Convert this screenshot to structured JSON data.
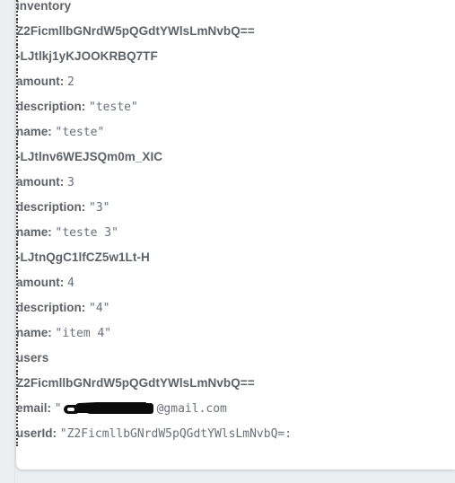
{
  "panel": {
    "name": "firebase-realtime-database-tree"
  },
  "tree": {
    "toggle_icon": "collapse-minus-icon",
    "roots": [
      {
        "label": "inventory",
        "children": [
          {
            "label": "Z2FicmllbGNrdW5pQGdtYWlsLmNvbQ==",
            "children": [
              {
                "label": "-LJtlkj1yKJOOKRBQ7TF",
                "leaves": [
                  {
                    "key": "amount:",
                    "value": "2"
                  },
                  {
                    "key": "description:",
                    "value": "\"teste\""
                  },
                  {
                    "key": "name:",
                    "value": "\"teste\""
                  }
                ]
              },
              {
                "label": "-LJtlnv6WEJSQm0m_XIC",
                "leaves": [
                  {
                    "key": "amount:",
                    "value": "3"
                  },
                  {
                    "key": "description:",
                    "value": "\"3\""
                  },
                  {
                    "key": "name:",
                    "value": "\"teste 3\""
                  }
                ]
              },
              {
                "label": "-LJtnQgC1lfCZ5w1Lt-H",
                "leaves": [
                  {
                    "key": "amount:",
                    "value": "4"
                  },
                  {
                    "key": "description:",
                    "value": "\"4\""
                  },
                  {
                    "key": "name:",
                    "value": "\"item 4\""
                  }
                ]
              }
            ]
          }
        ]
      },
      {
        "label": "users",
        "children": [
          {
            "label": "Z2FicmllbGNrdW5pQGdtYWlsLmNvbQ==",
            "leaves": [
              {
                "key": "email:",
                "value_prefix": "\"",
                "redacted": true,
                "value_suffix": "@gmail.com"
              },
              {
                "key": "userId:",
                "value": "\"Z2FicmllbGNrdW5pQGdtYWlsLmNvbQ=:"
              }
            ]
          }
        ]
      }
    ]
  },
  "colors": {
    "page_background": "#eaeef1",
    "panel_background": "#ffffff",
    "node_label": "#5d6268",
    "leaf_key": "#5d6268",
    "leaf_value": "#6a7078",
    "guide_line": "#3b3b3b",
    "toggle_border": "#9a9a9a",
    "redaction": "#0b0b0b"
  }
}
